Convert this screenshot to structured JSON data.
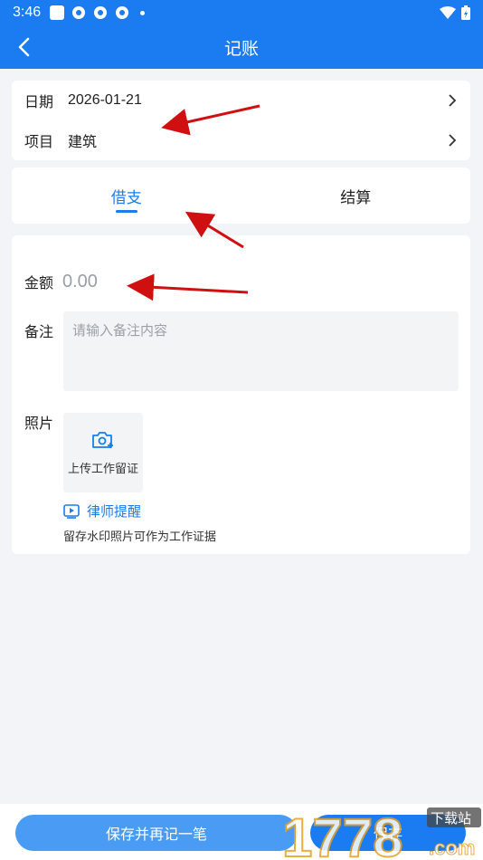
{
  "status_bar": {
    "time": "3:46"
  },
  "app_bar": {
    "title": "记账",
    "back_icon": "back-arrow-icon"
  },
  "info": {
    "date_label": "日期",
    "date_value": "2026-01-21",
    "project_label": "项目",
    "project_value": "建筑"
  },
  "tabs": [
    {
      "label": "借支",
      "active": true
    },
    {
      "label": "结算",
      "active": false
    }
  ],
  "form": {
    "amount_label": "金额",
    "amount_placeholder": "0.00",
    "memo_label": "备注",
    "memo_placeholder": "请输入备注内容",
    "photo_label": "照片",
    "upload_text": "上传工作留证",
    "lawyer_link": "律师提醒",
    "hint": "留存水印照片可作为工作证据"
  },
  "bottom": {
    "save_again": "保存并再记一笔",
    "save": "保存"
  },
  "watermark": {
    "digits": "1778",
    "site_label": "下载站",
    "domain_suffix": ".com"
  },
  "colors": {
    "primary": "#1a7cf0",
    "button_light": "#4a9bf4",
    "background": "#f2f4f8",
    "arrow": "#d01010"
  }
}
